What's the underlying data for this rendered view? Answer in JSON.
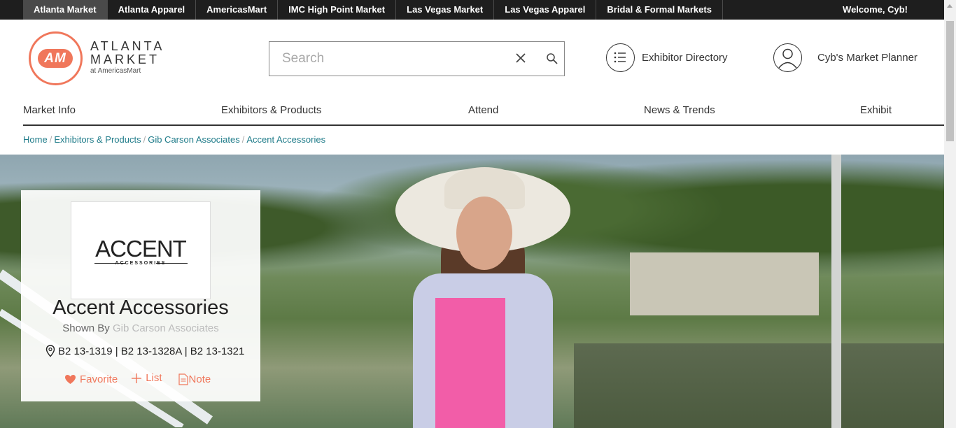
{
  "topbar": {
    "tabs": [
      {
        "label": "Atlanta Market"
      },
      {
        "label": "Atlanta Apparel"
      },
      {
        "label": "AmericasMart"
      },
      {
        "label": "IMC High Point Market"
      },
      {
        "label": "Las Vegas Market"
      },
      {
        "label": "Las Vegas Apparel"
      },
      {
        "label": "Bridal & Formal Markets"
      }
    ],
    "welcome": "Welcome, Cyb!"
  },
  "brand": {
    "monogram": "AM",
    "line1": "ATLANTA",
    "line2": "MARKET",
    "line3": "at AmericasMart",
    "accent_color": "#f0775b"
  },
  "search": {
    "placeholder": "Search",
    "value": ""
  },
  "header_links": {
    "directory": "Exhibitor Directory",
    "planner": "Cyb's Market Planner"
  },
  "nav": {
    "items": [
      {
        "label": "Market Info"
      },
      {
        "label": "Exhibitors & Products"
      },
      {
        "label": "Attend"
      },
      {
        "label": "News & Trends"
      },
      {
        "label": "Exhibit"
      }
    ]
  },
  "breadcrumb": {
    "items": [
      {
        "label": "Home"
      },
      {
        "label": "Exhibitors & Products"
      },
      {
        "label": "Gib Carson Associates"
      },
      {
        "label": "Accent Accessories"
      }
    ],
    "link_color": "#207c8a"
  },
  "exhibitor": {
    "logo_word": "ACCENT",
    "logo_sub": "ACCESSORIES",
    "name": "Accent Accessories",
    "shown_by_label": "Shown By",
    "shown_by": "Gib Carson Associates",
    "booths": "B2 13-1319 | B2 13-1328A | B2 13-1321",
    "favorite": "Favorite",
    "list": "List",
    "note": "Note"
  }
}
